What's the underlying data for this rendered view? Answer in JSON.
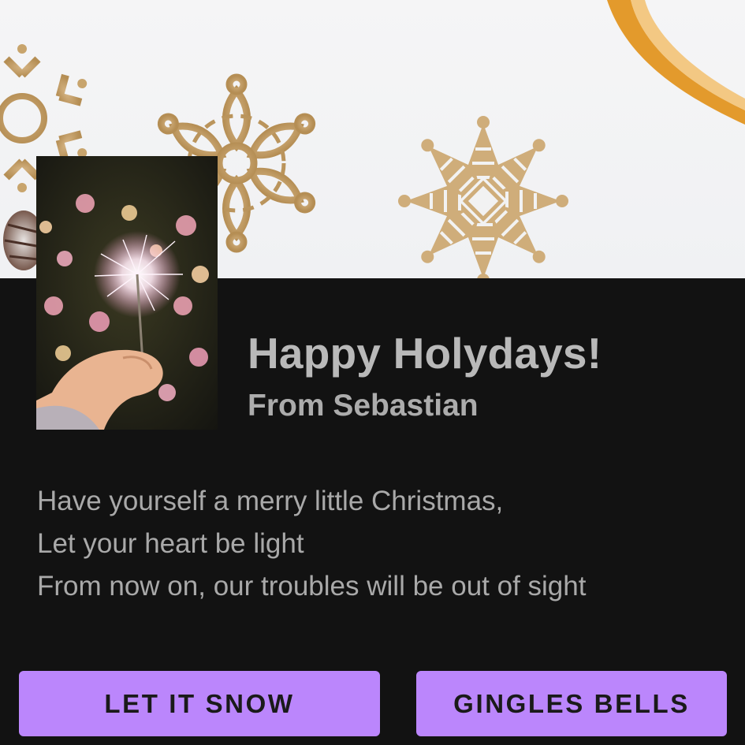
{
  "card": {
    "title": "Happy Holydays!",
    "subtitle": "From Sebastian",
    "body_lines": [
      "Have yourself a merry little Christmas,",
      "Let your heart be light",
      "From now on, our troubles will be out of sight"
    ]
  },
  "actions": {
    "primary_label": "LET IT SNOW",
    "secondary_label": "GINGLES BELLS"
  },
  "images": {
    "hero": "hero-image-snowflake-ornaments",
    "thumbnail": "thumbnail-image-sparkler"
  },
  "colors": {
    "background": "#121212",
    "button": "#bb86fc",
    "title_text": "#b9b9b9",
    "body_text": "#a9a9a9",
    "gold": "#c8a46c",
    "ribbon": "#e39a2c"
  }
}
